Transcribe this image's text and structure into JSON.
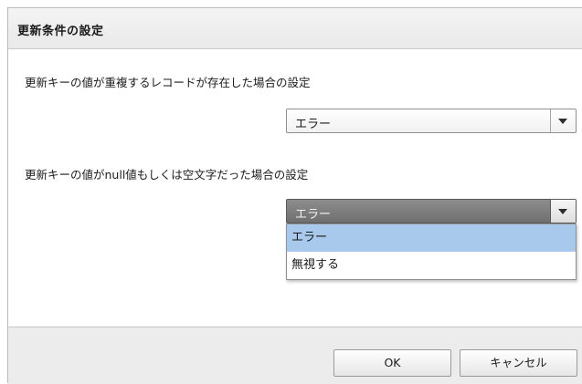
{
  "dialog": {
    "title": "更新条件の設定"
  },
  "setting1": {
    "label": "更新キーの値が重複するレコードが存在した場合の設定",
    "selected": "エラー"
  },
  "setting2": {
    "label": "更新キーの値がnull値もしくは空文字だった場合の設定",
    "selected": "エラー",
    "options": [
      "エラー",
      "無視する"
    ]
  },
  "footer": {
    "ok_label": "OK",
    "cancel_label": "キャンセル"
  },
  "colors": {
    "highlight": "#a8c8ec",
    "open_select_bg": "#7d7d7d"
  }
}
